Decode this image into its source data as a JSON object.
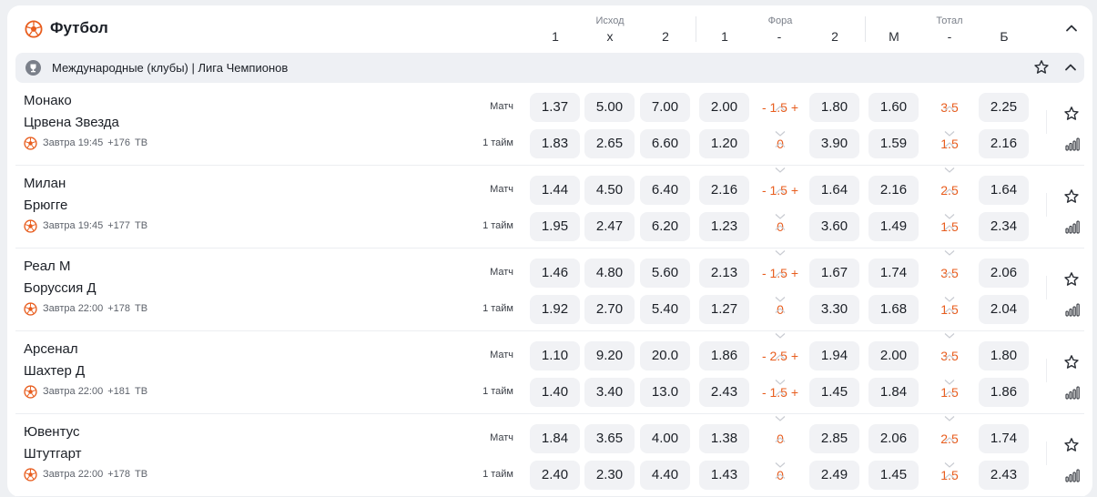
{
  "header": {
    "sport_title": "Футбол",
    "groups": [
      {
        "label": "Исход",
        "cols": [
          "1",
          "x",
          "2"
        ]
      },
      {
        "label": "Фора",
        "cols": [
          "1",
          "-",
          "2"
        ]
      },
      {
        "label": "Тотал",
        "cols": [
          "М",
          "-",
          "Б"
        ]
      }
    ],
    "icons": {
      "sport": "soccer-ball-icon",
      "collapse": "chevron-up-icon"
    }
  },
  "league": {
    "name": "Международные (клубы) | Лига Чемпионов",
    "icons": {
      "league": "trophy-icon",
      "favorite": "star-icon",
      "collapse": "chevron-up-icon"
    }
  },
  "colors": {
    "accent": "#e85d1e",
    "odd_bg": "#f1f2f5",
    "league_bg": "#eef0f4"
  },
  "events": [
    {
      "team1": "Монако",
      "team2": "Црвена Звезда",
      "time": "Завтра 19:45",
      "more_markets": "+176",
      "tv": "ТВ",
      "rows": [
        {
          "period": "Матч",
          "w1": "1.37",
          "x": "5.00",
          "w2": "7.00",
          "h1": "2.00",
          "h_param": "- 1.5 +",
          "h2": "1.80",
          "under": "1.60",
          "t_param": "3.5",
          "over": "2.25"
        },
        {
          "period": "1 тайм",
          "w1": "1.83",
          "x": "2.65",
          "w2": "6.60",
          "h1": "1.20",
          "h_param": "0",
          "h2": "3.90",
          "under": "1.59",
          "t_param": "1.5",
          "over": "2.16"
        }
      ]
    },
    {
      "team1": "Милан",
      "team2": "Брюгге",
      "time": "Завтра 19:45",
      "more_markets": "+177",
      "tv": "ТВ",
      "rows": [
        {
          "period": "Матч",
          "w1": "1.44",
          "x": "4.50",
          "w2": "6.40",
          "h1": "2.16",
          "h_param": "- 1.5 +",
          "h2": "1.64",
          "under": "2.16",
          "t_param": "2.5",
          "over": "1.64"
        },
        {
          "period": "1 тайм",
          "w1": "1.95",
          "x": "2.47",
          "w2": "6.20",
          "h1": "1.23",
          "h_param": "0",
          "h2": "3.60",
          "under": "1.49",
          "t_param": "1.5",
          "over": "2.34"
        }
      ]
    },
    {
      "team1": "Реал М",
      "team2": "Боруссия Д",
      "time": "Завтра 22:00",
      "more_markets": "+178",
      "tv": "ТВ",
      "rows": [
        {
          "period": "Матч",
          "w1": "1.46",
          "x": "4.80",
          "w2": "5.60",
          "h1": "2.13",
          "h_param": "- 1.5 +",
          "h2": "1.67",
          "under": "1.74",
          "t_param": "3.5",
          "over": "2.06"
        },
        {
          "period": "1 тайм",
          "w1": "1.92",
          "x": "2.70",
          "w2": "5.40",
          "h1": "1.27",
          "h_param": "0",
          "h2": "3.30",
          "under": "1.68",
          "t_param": "1.5",
          "over": "2.04"
        }
      ]
    },
    {
      "team1": "Арсенал",
      "team2": "Шахтер Д",
      "time": "Завтра 22:00",
      "more_markets": "+181",
      "tv": "ТВ",
      "rows": [
        {
          "period": "Матч",
          "w1": "1.10",
          "x": "9.20",
          "w2": "20.0",
          "h1": "1.86",
          "h_param": "- 2.5 +",
          "h2": "1.94",
          "under": "2.00",
          "t_param": "3.5",
          "over": "1.80"
        },
        {
          "period": "1 тайм",
          "w1": "1.40",
          "x": "3.40",
          "w2": "13.0",
          "h1": "2.43",
          "h_param": "- 1.5 +",
          "h2": "1.45",
          "under": "1.84",
          "t_param": "1.5",
          "over": "1.86"
        }
      ]
    },
    {
      "team1": "Ювентус",
      "team2": "Штутгарт",
      "time": "Завтра 22:00",
      "more_markets": "+178",
      "tv": "ТВ",
      "rows": [
        {
          "period": "Матч",
          "w1": "1.84",
          "x": "3.65",
          "w2": "4.00",
          "h1": "1.38",
          "h_param": "0",
          "h2": "2.85",
          "under": "2.06",
          "t_param": "2.5",
          "over": "1.74"
        },
        {
          "period": "1 тайм",
          "w1": "2.40",
          "x": "2.30",
          "w2": "4.40",
          "h1": "1.43",
          "h_param": "0",
          "h2": "2.49",
          "under": "1.45",
          "t_param": "1.5",
          "over": "2.43"
        }
      ]
    }
  ]
}
